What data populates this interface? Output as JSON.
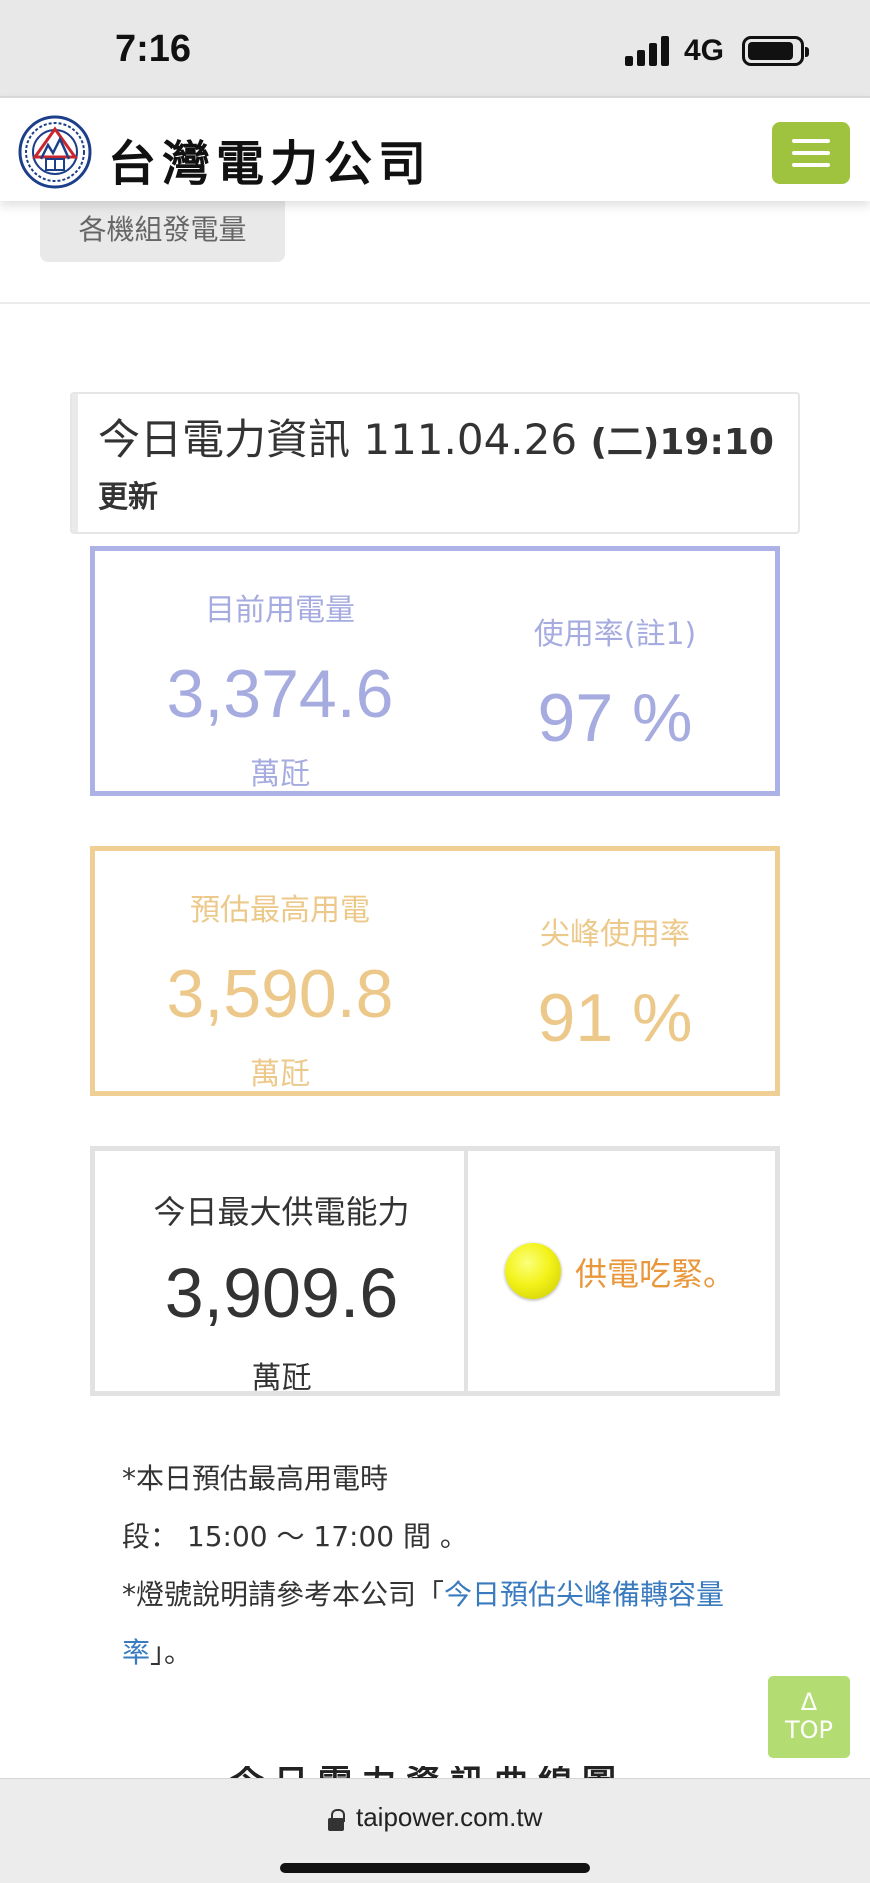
{
  "status_bar": {
    "time": "7:16",
    "network": "4G",
    "icons": [
      "signal-icon",
      "battery-icon"
    ]
  },
  "header": {
    "logo_text": "台灣電力公司",
    "logo_emblem": "taipower-emblem",
    "menu_icon": "hamburger-menu-icon",
    "brand_color": "#9fc33f"
  },
  "tab": {
    "label": "各機組發電量"
  },
  "info": {
    "title": "今日電力資訊 111.04.26 ",
    "time": "(二)19:10",
    "update_label": "更新"
  },
  "current_usage": {
    "label": "目前用電量",
    "value": "3,374.6",
    "unit": "萬瓩",
    "rate_label": "使用率(註1)",
    "rate_value": "97 %",
    "color": "#adb2e6"
  },
  "forecast": {
    "label": "預估最高用電",
    "value": "3,590.8",
    "unit": "萬瓩",
    "rate_label": "尖峰使用率",
    "rate_value": "91 %",
    "color": "#efcf93"
  },
  "capacity": {
    "label": "今日最大供電能力",
    "value": "3,909.6",
    "unit": "萬瓩",
    "status_text": "供電吃緊。",
    "status_color": "#f3f31a",
    "status_icon": "yellow-light-icon"
  },
  "notes": {
    "line1": "*本日預估最高用電時",
    "line2": "段： 15:00 ～ 17:00  間  。",
    "line3_prefix": "*燈號說明請參考本公司「",
    "link_part1": "今日預估尖峰備轉容量",
    "link_part2": "率",
    "line3_suffix": "」。"
  },
  "top_button": {
    "arrow": "Δ",
    "label": "TOP"
  },
  "next_section": {
    "heading": "今日電力資訊曲線圖"
  },
  "browser": {
    "url": "taipower.com.tw",
    "lock_icon": "lock-icon"
  }
}
